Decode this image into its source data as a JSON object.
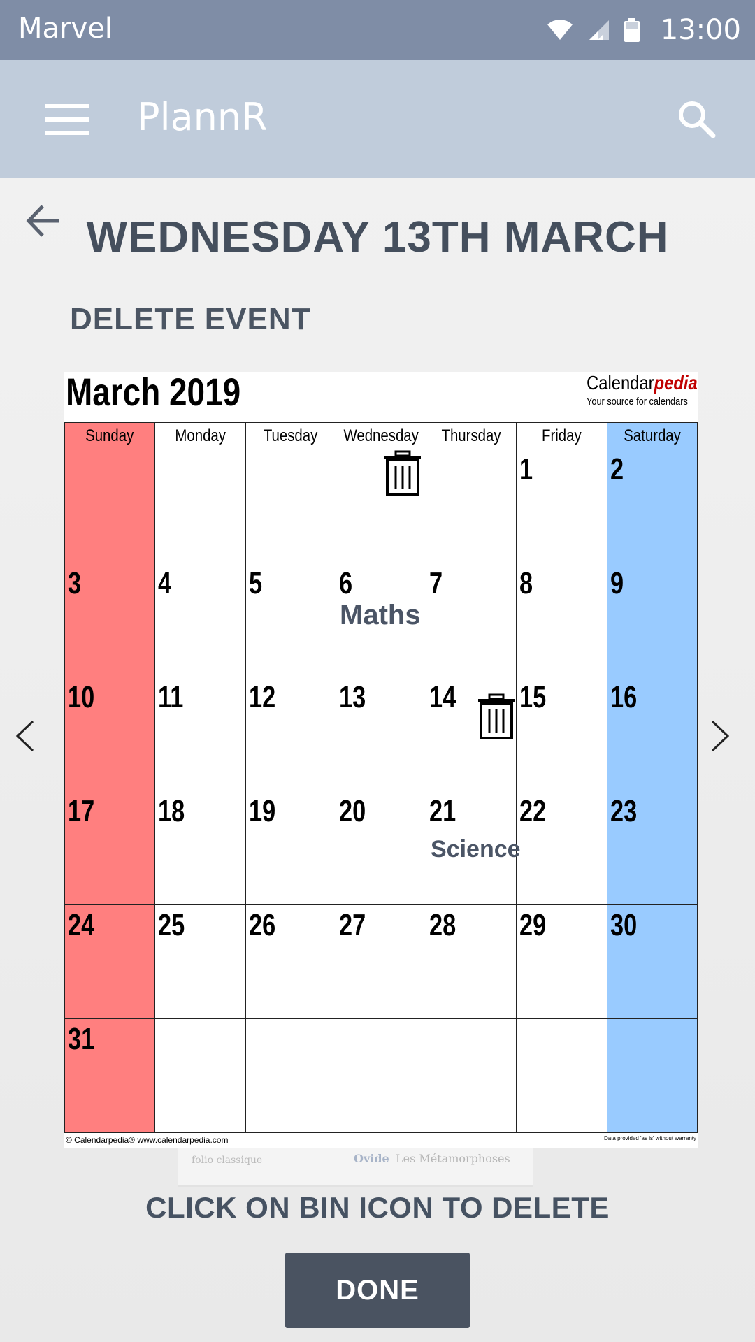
{
  "status_bar": {
    "app_name": "Marvel",
    "time": "13:00"
  },
  "app_bar": {
    "title": "PlannR"
  },
  "page": {
    "title": "WEDNESDAY 13TH MARCH",
    "subtitle": "DELETE EVENT",
    "hint": "CLICK ON BIN ICON TO DELETE",
    "done_label": "DONE"
  },
  "calendar": {
    "month_title": "March 2019",
    "brand_prefix": "Calendar",
    "brand_accent": "pedia",
    "brand_tagline": "Your source for calendars",
    "weekdays": [
      "Sunday",
      "Monday",
      "Tuesday",
      "Wednesday",
      "Thursday",
      "Friday",
      "Saturday"
    ],
    "weeks": [
      [
        "",
        "",
        "",
        "",
        "",
        "1",
        "2"
      ],
      [
        "3",
        "4",
        "5",
        "6",
        "7",
        "8",
        "9"
      ],
      [
        "10",
        "11",
        "12",
        "13",
        "14",
        "15",
        "16"
      ],
      [
        "17",
        "18",
        "19",
        "20",
        "21",
        "22",
        "23"
      ],
      [
        "24",
        "25",
        "26",
        "27",
        "28",
        "29",
        "30"
      ],
      [
        "31",
        "",
        "",
        "",
        "",
        "",
        ""
      ]
    ],
    "footer_left": "© Calendarpedia®   www.calendarpedia.com",
    "footer_right": "Data provided 'as is' without warranty",
    "events": [
      {
        "label": "Maths",
        "day": "6"
      },
      {
        "label": "Science",
        "day": "21"
      }
    ],
    "colors": {
      "sunday": "#ff7f7f",
      "saturday": "#99cbff"
    }
  },
  "book": {
    "publisher": "folio classique",
    "author": "Ovide",
    "title": "Les Métamorphoses"
  },
  "colors": {
    "status_bar": "#7f8da6",
    "app_bar": "#c0ccdb",
    "button": "#4a5361",
    "text": "#454f5d"
  }
}
